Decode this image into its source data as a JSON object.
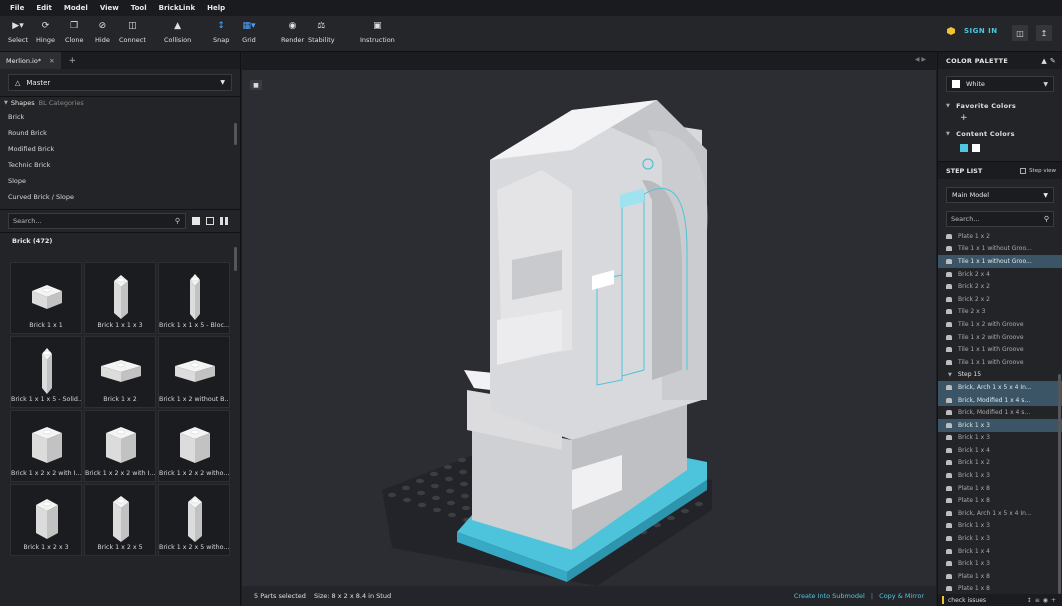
{
  "menu": [
    "File",
    "Edit",
    "Model",
    "View",
    "Tool",
    "BrickLink",
    "Help"
  ],
  "toolbar": {
    "tools": [
      {
        "label": "Select",
        "icon": "cursor-icon"
      },
      {
        "label": "Hinge",
        "icon": "hinge-icon"
      },
      {
        "label": "Clone",
        "icon": "clone-icon"
      },
      {
        "label": "Hide",
        "icon": "hide-icon"
      },
      {
        "label": "Connect",
        "icon": "connect-icon"
      },
      {
        "label": "Collision",
        "icon": "collision-icon"
      },
      {
        "label": "Snap",
        "icon": "snap-icon"
      },
      {
        "label": "Grid",
        "icon": "grid-icon"
      },
      {
        "label": "Render",
        "icon": "camera-icon"
      },
      {
        "label": "Stability",
        "icon": "stability-icon"
      },
      {
        "label": "Instruction",
        "icon": "instruction-icon"
      }
    ],
    "sign_in": "SIGN IN"
  },
  "left": {
    "doc_tab": "Merlion.io*",
    "master": "Master",
    "tabs": {
      "shapes": "Shapes",
      "bl": "BL Categories"
    },
    "categories": [
      "Brick",
      "Round Brick",
      "Modified Brick",
      "Technic Brick",
      "Slope",
      "Curved Brick / Slope"
    ],
    "search_placeholder": "Search...",
    "brick_header": "Brick (472)",
    "bricks": [
      "Brick 1 x 1",
      "Brick 1 x 1 x 3",
      "Brick 1 x 1 x 5 - Bloc...",
      "Brick 1 x 1 x 5 - Solid...",
      "Brick 1 x 2",
      "Brick 1 x 2 without B...",
      "Brick 1 x 2 x 2 with I...",
      "Brick 1 x 2 x 2 with I...",
      "Brick 1 x 2 x 2 witho...",
      "Brick 1 x 2 x 3",
      "Brick 1 x 2 x 5",
      "Brick 1 x 2 x 5 witho..."
    ]
  },
  "viewport": {
    "status": "5 Parts selected",
    "size": "Size: 8 x 2 x 8.4 in Stud",
    "link_submodel": "Create Into Submodel",
    "link_sep": "|",
    "link_mirror": "Copy & Mirror"
  },
  "right": {
    "color_palette": "COLOR PALETTE",
    "selected_color": "White",
    "favorite_colors": "Favorite Colors",
    "content_colors": "Content Colors",
    "content_swatches": [
      "#4dc8e0",
      "#ffffff"
    ],
    "step_list": "STEP LIST",
    "step_view": "Step view",
    "model": "Main Model",
    "search_placeholder": "Search...",
    "steps": [
      {
        "label": "Plate 1 x 2",
        "sel": false
      },
      {
        "label": "Tile 1 x 1 without Groo...",
        "sel": false
      },
      {
        "label": "Tile 1 x 1 without Groo...",
        "sel": true
      },
      {
        "label": "Brick 2 x 4",
        "sel": false
      },
      {
        "label": "Brick 2 x 2",
        "sel": false
      },
      {
        "label": "Brick 2 x 2",
        "sel": false
      },
      {
        "label": "Tile 2 x 3",
        "sel": false
      },
      {
        "label": "Tile 1 x 2 with Groove",
        "sel": false
      },
      {
        "label": "Tile 1 x 2 with Groove",
        "sel": false
      },
      {
        "label": "Tile 1 x 1 with Groove",
        "sel": false
      },
      {
        "label": "Tile 1 x 1 with Groove",
        "sel": false
      },
      {
        "label": "Step 15",
        "header": true
      },
      {
        "label": "Brick, Arch 1 x 5 x 4 In...",
        "sel": true
      },
      {
        "label": "Brick, Modified 1 x 4 s...",
        "sel": true
      },
      {
        "label": "Brick, Modified 1 x 4 s...",
        "sel": false
      },
      {
        "label": "Brick 1 x 3",
        "sel": true
      },
      {
        "label": "Brick 1 x 3",
        "sel": false
      },
      {
        "label": "Brick 1 x 4",
        "sel": false
      },
      {
        "label": "Brick 1 x 2",
        "sel": false
      },
      {
        "label": "Brick 1 x 3",
        "sel": false
      },
      {
        "label": "Plate 1 x 8",
        "sel": false
      },
      {
        "label": "Plate 1 x 8",
        "sel": false
      },
      {
        "label": "Brick, Arch 1 x 5 x 4 In...",
        "sel": false
      },
      {
        "label": "Brick 1 x 3",
        "sel": false
      },
      {
        "label": "Brick 1 x 3",
        "sel": false
      },
      {
        "label": "Brick 1 x 4",
        "sel": false
      },
      {
        "label": "Brick 1 x 3",
        "sel": false
      },
      {
        "label": "Plate 1 x 8",
        "sel": false
      },
      {
        "label": "Plate 1 x 8",
        "sel": false
      }
    ],
    "check_issues": "check issues"
  }
}
